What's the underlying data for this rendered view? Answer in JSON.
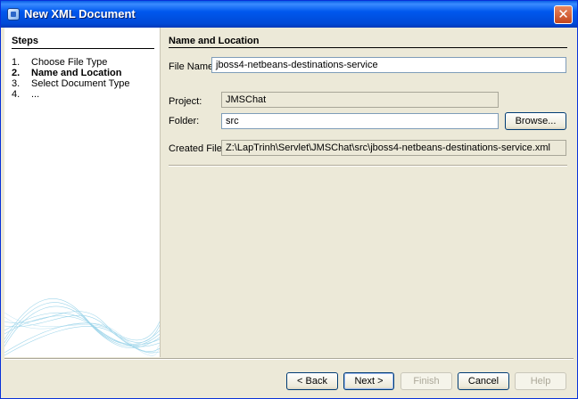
{
  "window": {
    "title": "New XML Document",
    "close_glyph": "✕"
  },
  "steps": {
    "title": "Steps",
    "items": [
      {
        "num": "1.",
        "label": "Choose File Type"
      },
      {
        "num": "2.",
        "label": "Name and Location"
      },
      {
        "num": "3.",
        "label": "Select Document Type"
      },
      {
        "num": "4.",
        "label": "..."
      }
    ],
    "current_index": 1
  },
  "panel": {
    "title": "Name and Location",
    "file_name_label": "File Name:",
    "file_name_value": "jboss4-netbeans-destinations-service",
    "project_label": "Project:",
    "project_value": "JMSChat",
    "folder_label": "Folder:",
    "folder_value": "src",
    "browse_label": "Browse...",
    "created_file_label": "Created File:",
    "created_file_value": "Z:\\LapTrinh\\Servlet\\JMSChat\\src\\jboss4-netbeans-destinations-service.xml"
  },
  "buttons": {
    "back": "< Back",
    "next": "Next >",
    "finish": "Finish",
    "cancel": "Cancel",
    "help": "Help"
  },
  "colors": {
    "titlebar": "#0058ee",
    "dialog_bg": "#ece9d8",
    "wave": "#4fb3d9"
  }
}
